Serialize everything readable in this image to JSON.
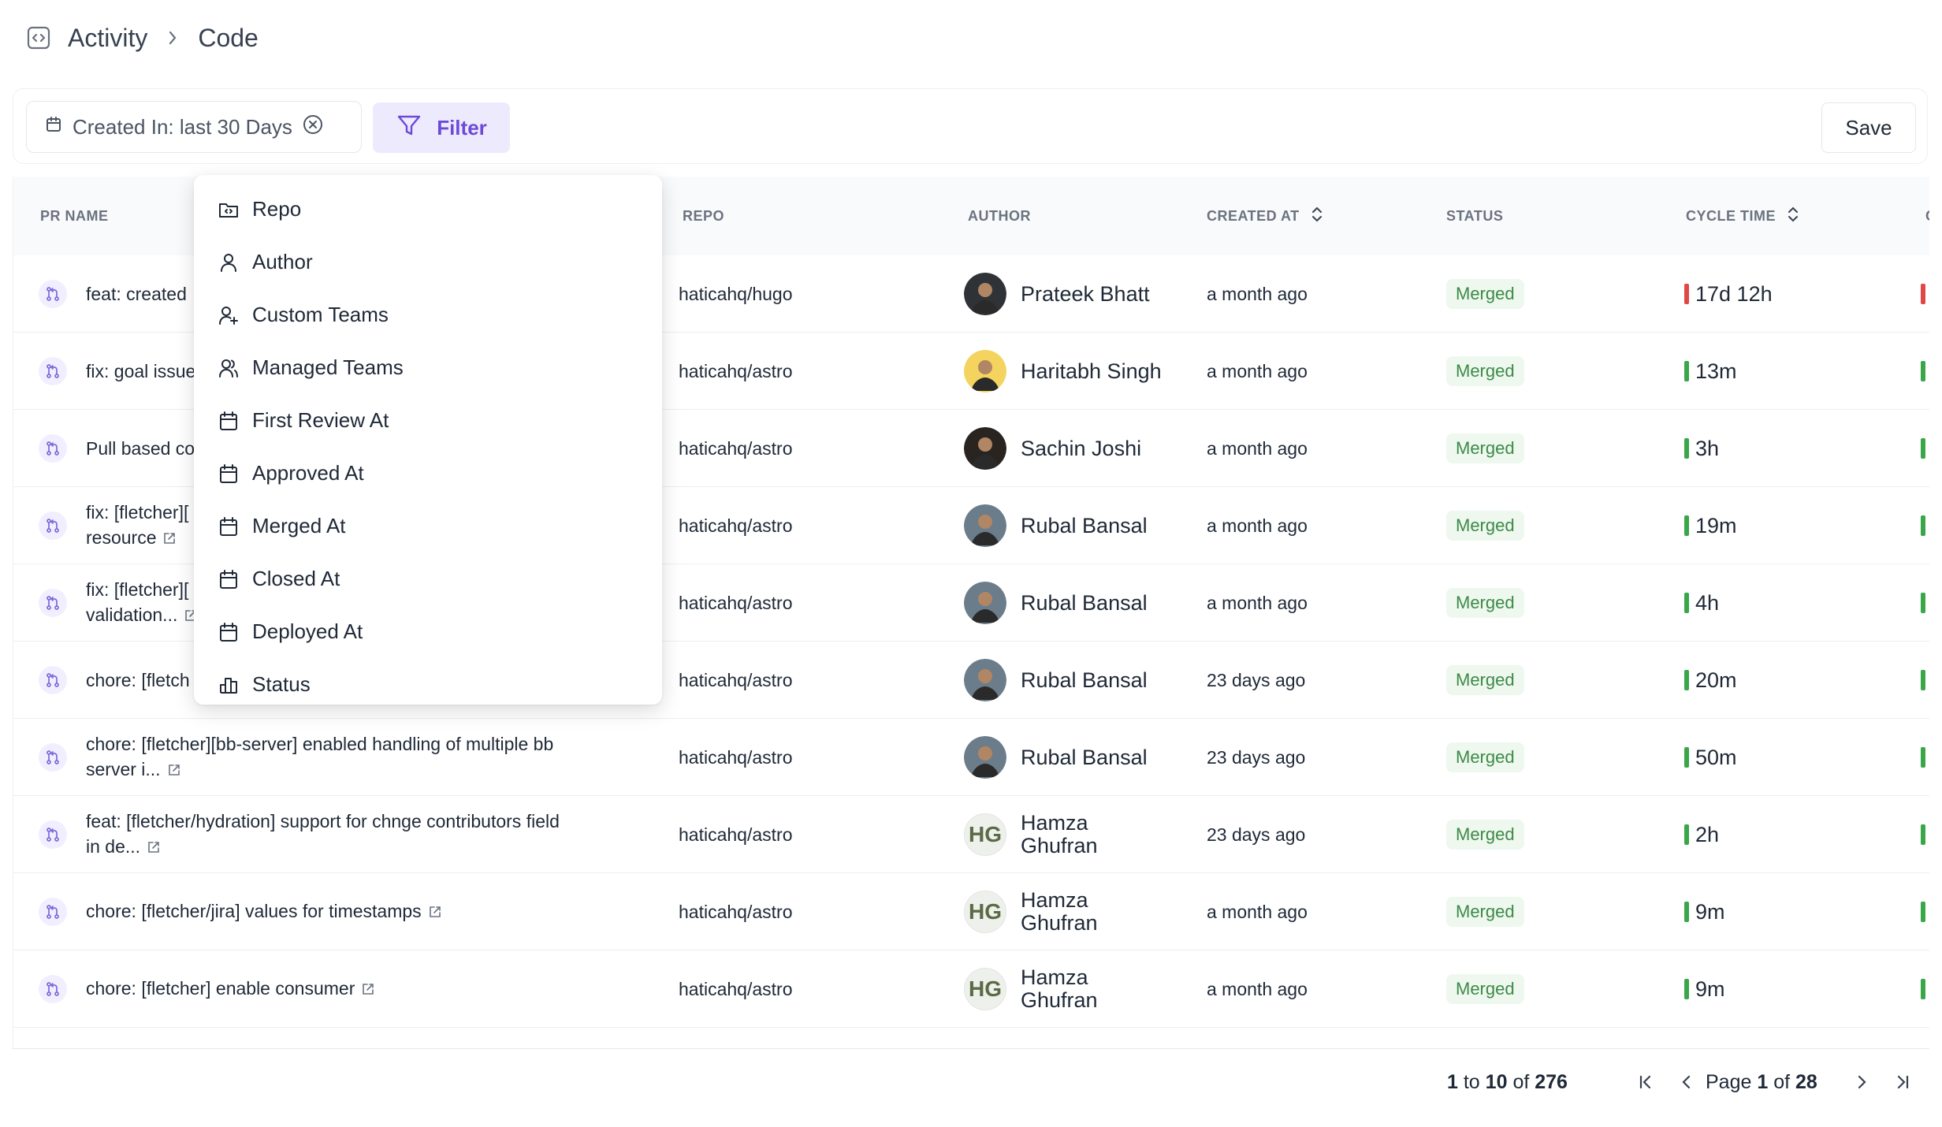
{
  "breadcrumb": {
    "section": "Activity",
    "page": "Code"
  },
  "toolbar": {
    "date_filter_label": "Created In: last 30 Days",
    "filter_label": "Filter",
    "save_label": "Save"
  },
  "table": {
    "columns": [
      "PR NAME",
      "REPO",
      "AUTHOR",
      "CREATED AT",
      "STATUS",
      "CYCLE TIME",
      "C"
    ],
    "rows": [
      {
        "name_line1": "feat: created",
        "name_line2": "",
        "repo": "haticahq/hugo",
        "author_line1": "Prateek Bhatt",
        "author_line2": "",
        "avatar": "photo",
        "created": "a month ago",
        "status": "Merged",
        "cycle": "17d 12h",
        "bar": "#e04848"
      },
      {
        "name_line1": "fix: goal issue",
        "name_line2": "",
        "repo": "haticahq/astro",
        "author_line1": "Haritabh Singh",
        "author_line2": "",
        "avatar": "photo",
        "created": "a month ago",
        "status": "Merged",
        "cycle": "13m",
        "bar": "#3aa64a"
      },
      {
        "name_line1": "Pull based co",
        "name_line2": "",
        "repo": "haticahq/astro",
        "author_line1": "Sachin Joshi",
        "author_line2": "",
        "avatar": "photo",
        "created": "a month ago",
        "status": "Merged",
        "cycle": "3h",
        "bar": "#3aa64a"
      },
      {
        "name_line1": "fix: [fletcher][",
        "name_line2": "resource",
        "repo": "haticahq/astro",
        "author_line1": "Rubal Bansal",
        "author_line2": "",
        "avatar": "photo",
        "created": "a month ago",
        "status": "Merged",
        "cycle": "19m",
        "bar": "#3aa64a"
      },
      {
        "name_line1": "fix: [fletcher][",
        "name_line2": "validation...",
        "repo": "haticahq/astro",
        "author_line1": "Rubal Bansal",
        "author_line2": "",
        "avatar": "photo",
        "created": "a month ago",
        "status": "Merged",
        "cycle": "4h",
        "bar": "#3aa64a"
      },
      {
        "name_line1": "chore: [fletch",
        "name_line2": "",
        "repo": "haticahq/astro",
        "author_line1": "Rubal Bansal",
        "author_line2": "",
        "avatar": "photo",
        "created": "23 days ago",
        "status": "Merged",
        "cycle": "20m",
        "bar": "#3aa64a"
      },
      {
        "name_line1": "chore: [fletcher][bb-server] enabled handling of multiple bb",
        "name_line2": "server i...",
        "repo": "haticahq/astro",
        "author_line1": "Rubal Bansal",
        "author_line2": "",
        "avatar": "photo",
        "created": "23 days ago",
        "status": "Merged",
        "cycle": "50m",
        "bar": "#3aa64a"
      },
      {
        "name_line1": "feat: [fletcher/hydration] support for chnge contributors field",
        "name_line2": "in de...",
        "repo": "haticahq/astro",
        "author_line1": "Hamza",
        "author_line2": "Ghufran",
        "avatar": "HG",
        "created": "23 days ago",
        "status": "Merged",
        "cycle": "2h",
        "bar": "#3aa64a"
      },
      {
        "name_line1": "chore: [fletcher/jira] values for timestamps",
        "name_line2": "",
        "repo": "haticahq/astro",
        "author_line1": "Hamza",
        "author_line2": "Ghufran",
        "avatar": "HG",
        "created": "a month ago",
        "status": "Merged",
        "cycle": "9m",
        "bar": "#3aa64a"
      },
      {
        "name_line1": "chore: [fletcher] enable consumer",
        "name_line2": "",
        "repo": "haticahq/astro",
        "author_line1": "Hamza",
        "author_line2": "Ghufran",
        "avatar": "HG",
        "created": "a month ago",
        "status": "Merged",
        "cycle": "9m",
        "bar": "#3aa64a"
      }
    ]
  },
  "pagination": {
    "from": "1",
    "to_word": "to",
    "to": "10",
    "of_word": "of",
    "total": "276",
    "page_word": "Page",
    "page": "1",
    "of_word2": "of",
    "pages": "28"
  },
  "filter_menu": {
    "items": [
      {
        "label": "Repo",
        "icon": "repo-icon"
      },
      {
        "label": "Author",
        "icon": "user-icon"
      },
      {
        "label": "Custom Teams",
        "icon": "user-plus-icon"
      },
      {
        "label": "Managed Teams",
        "icon": "users-icon"
      },
      {
        "label": "First Review At",
        "icon": "calendar-icon"
      },
      {
        "label": "Approved At",
        "icon": "calendar-icon"
      },
      {
        "label": "Merged At",
        "icon": "calendar-icon"
      },
      {
        "label": "Closed At",
        "icon": "calendar-icon"
      },
      {
        "label": "Deployed At",
        "icon": "calendar-icon"
      },
      {
        "label": "Status",
        "icon": "bar-chart-icon"
      }
    ]
  },
  "colors": {
    "accent": "#6c4ad8",
    "merged_bg": "#eef8ef",
    "merged_text": "#3d8a47",
    "danger": "#e04848",
    "success": "#3aa64a"
  }
}
